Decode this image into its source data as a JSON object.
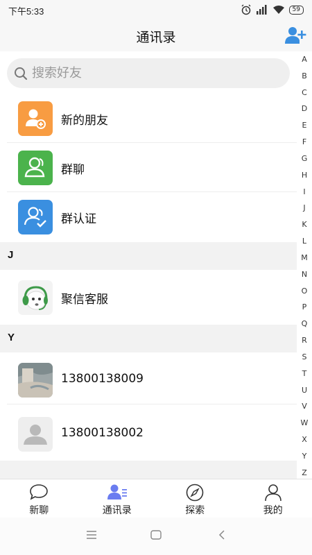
{
  "status": {
    "time": "下午5:33",
    "battery": "59"
  },
  "header": {
    "title": "通讯录"
  },
  "search": {
    "placeholder": "搜索好友"
  },
  "top_items": [
    {
      "label": "新的朋友",
      "icon": "add-friend-icon",
      "color": "#f89c42"
    },
    {
      "label": "群聊",
      "icon": "group-icon",
      "color": "#4bb34c"
    },
    {
      "label": "群认证",
      "icon": "group-verify-icon",
      "color": "#3a8fe0"
    }
  ],
  "sections": [
    {
      "letter": "J",
      "contacts": [
        {
          "name": "聚信客服",
          "avatar": "customer-service-avatar"
        }
      ]
    },
    {
      "letter": "Y",
      "contacts": [
        {
          "name": "13800138009",
          "avatar": "photo-avatar"
        },
        {
          "name": "13800138002",
          "avatar": "default-avatar"
        }
      ]
    }
  ],
  "index_letters": [
    "A",
    "B",
    "C",
    "D",
    "E",
    "F",
    "G",
    "H",
    "I",
    "J",
    "K",
    "L",
    "M",
    "N",
    "O",
    "P",
    "Q",
    "R",
    "S",
    "T",
    "U",
    "V",
    "W",
    "X",
    "Y",
    "Z"
  ],
  "tabs": [
    {
      "label": "新聊",
      "icon": "chat-bubble-icon"
    },
    {
      "label": "通讯录",
      "icon": "contacts-icon",
      "active": true
    },
    {
      "label": "探索",
      "icon": "compass-icon"
    },
    {
      "label": "我的",
      "icon": "person-icon"
    }
  ],
  "colors": {
    "accent": "#3a8fe0",
    "tab_active": "#6a7cf0",
    "section_bg": "#f2f2f2"
  }
}
